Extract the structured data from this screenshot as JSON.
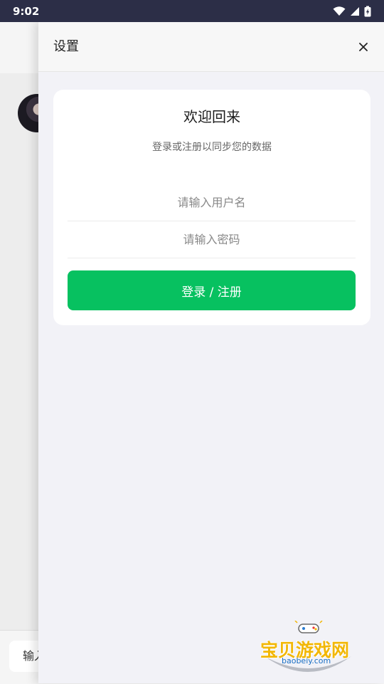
{
  "status_bar": {
    "time": "9:02",
    "icons": [
      "wifi-icon",
      "cellular-signal-icon",
      "battery-charging-icon"
    ]
  },
  "background_app": {
    "input_placeholder": "输入"
  },
  "drawer": {
    "title": "设置",
    "close_icon": "close-icon",
    "card": {
      "title": "欢迎回来",
      "subtitle": "登录或注册以同步您的数据",
      "username_placeholder": "请输入用户名",
      "password_placeholder": "请输入密码",
      "submit_label": "登录 / 注册"
    }
  },
  "watermark": {
    "text": "宝贝游戏网",
    "url": "baobeiy.com"
  },
  "colors": {
    "status_bar": "#2c2e47",
    "accent_green": "#07c160",
    "drawer_bg": "#f2f2f7"
  }
}
